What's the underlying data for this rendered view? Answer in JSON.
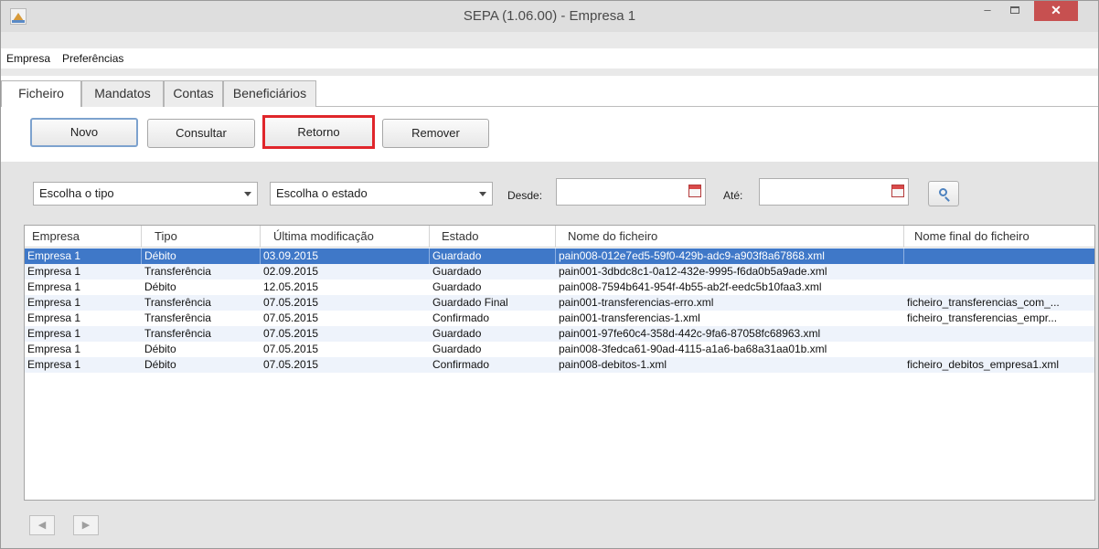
{
  "window": {
    "title": "SEPA  (1.06.00) - Empresa 1",
    "controls": {
      "minimize": "–",
      "close": "✕"
    }
  },
  "menubar": {
    "items": [
      "Empresa",
      "Preferências"
    ]
  },
  "tabs": {
    "items": [
      {
        "label": "Ficheiro",
        "active": true
      },
      {
        "label": "Mandatos",
        "active": false
      },
      {
        "label": "Contas",
        "active": false
      },
      {
        "label": "Beneficiários",
        "active": false
      }
    ]
  },
  "toolbar": {
    "novo": "Novo",
    "consultar": "Consultar",
    "retorno": "Retorno",
    "remover": "Remover"
  },
  "filters": {
    "tipo": "Escolha o tipo",
    "estado": "Escolha o estado",
    "desde_label": "Desde:",
    "desde_value": "",
    "ate_label": "Até:",
    "ate_value": ""
  },
  "table": {
    "columns": [
      "Empresa",
      "Tipo",
      "Última modificação",
      "Estado",
      "Nome do ficheiro",
      "Nome final do ficheiro"
    ],
    "rows": [
      [
        "Empresa 1",
        "Débito",
        "03.09.2015",
        "Guardado",
        "pain008-012e7ed5-59f0-429b-adc9-a903f8a67868.xml",
        ""
      ],
      [
        "Empresa 1",
        "Transferência",
        "02.09.2015",
        "Guardado",
        "pain001-3dbdc8c1-0a12-432e-9995-f6da0b5a9ade.xml",
        ""
      ],
      [
        "Empresa 1",
        "Débito",
        "12.05.2015",
        "Guardado",
        "pain008-7594b641-954f-4b55-ab2f-eedc5b10faa3.xml",
        ""
      ],
      [
        "Empresa 1",
        "Transferência",
        "07.05.2015",
        "Guardado Final",
        "pain001-transferencias-erro.xml",
        "ficheiro_transferencias_com_..."
      ],
      [
        "Empresa 1",
        "Transferência",
        "07.05.2015",
        "Confirmado",
        "pain001-transferencias-1.xml",
        "ficheiro_transferencias_empr..."
      ],
      [
        "Empresa 1",
        "Transferência",
        "07.05.2015",
        "Guardado",
        "pain001-97fe60c4-358d-442c-9fa6-87058fc68963.xml",
        ""
      ],
      [
        "Empresa 1",
        "Débito",
        "07.05.2015",
        "Guardado",
        "pain008-3fedca61-90ad-4115-a1a6-ba68a31aa01b.xml",
        ""
      ],
      [
        "Empresa 1",
        "Débito",
        "07.05.2015",
        "Confirmado",
        "pain008-debitos-1.xml",
        "ficheiro_debitos_empresa1.xml"
      ]
    ],
    "selected_row": 0
  },
  "pager": {
    "prev": "◀",
    "next": "▶"
  },
  "colors": {
    "selection": "#3f78c8",
    "highlight_border": "#e0262b",
    "close_button": "#c75050"
  }
}
